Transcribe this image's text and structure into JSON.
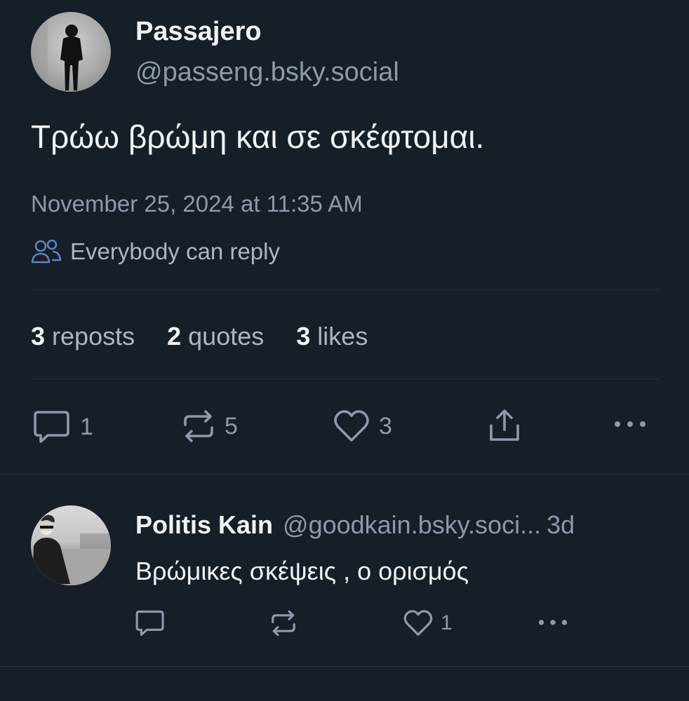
{
  "post": {
    "author": {
      "display_name": "Passajero",
      "handle": "@passeng.bsky.social"
    },
    "text": "Τρώω βρώμη και σε σκέφτομαι.",
    "timestamp": "November 25, 2024 at 11:35 AM",
    "reply_setting": "Everybody can reply",
    "counts": [
      {
        "num": "3",
        "label": "reposts"
      },
      {
        "num": "2",
        "label": "quotes"
      },
      {
        "num": "3",
        "label": "likes"
      }
    ],
    "actions": {
      "reply_count": "1",
      "repost_count": "5",
      "like_count": "3"
    }
  },
  "reply": {
    "author": {
      "display_name": "Politis Kain",
      "handle": "@goodkain.bsky.soci...",
      "age": "3d"
    },
    "text": "Βρώμικες σκέψεις , ο ορισμός",
    "actions": {
      "like_count": "1"
    }
  },
  "colors": {
    "background": "#161e27",
    "text": "#f1f3f5",
    "muted": "#8c9aab",
    "divider": "#2a3441"
  }
}
